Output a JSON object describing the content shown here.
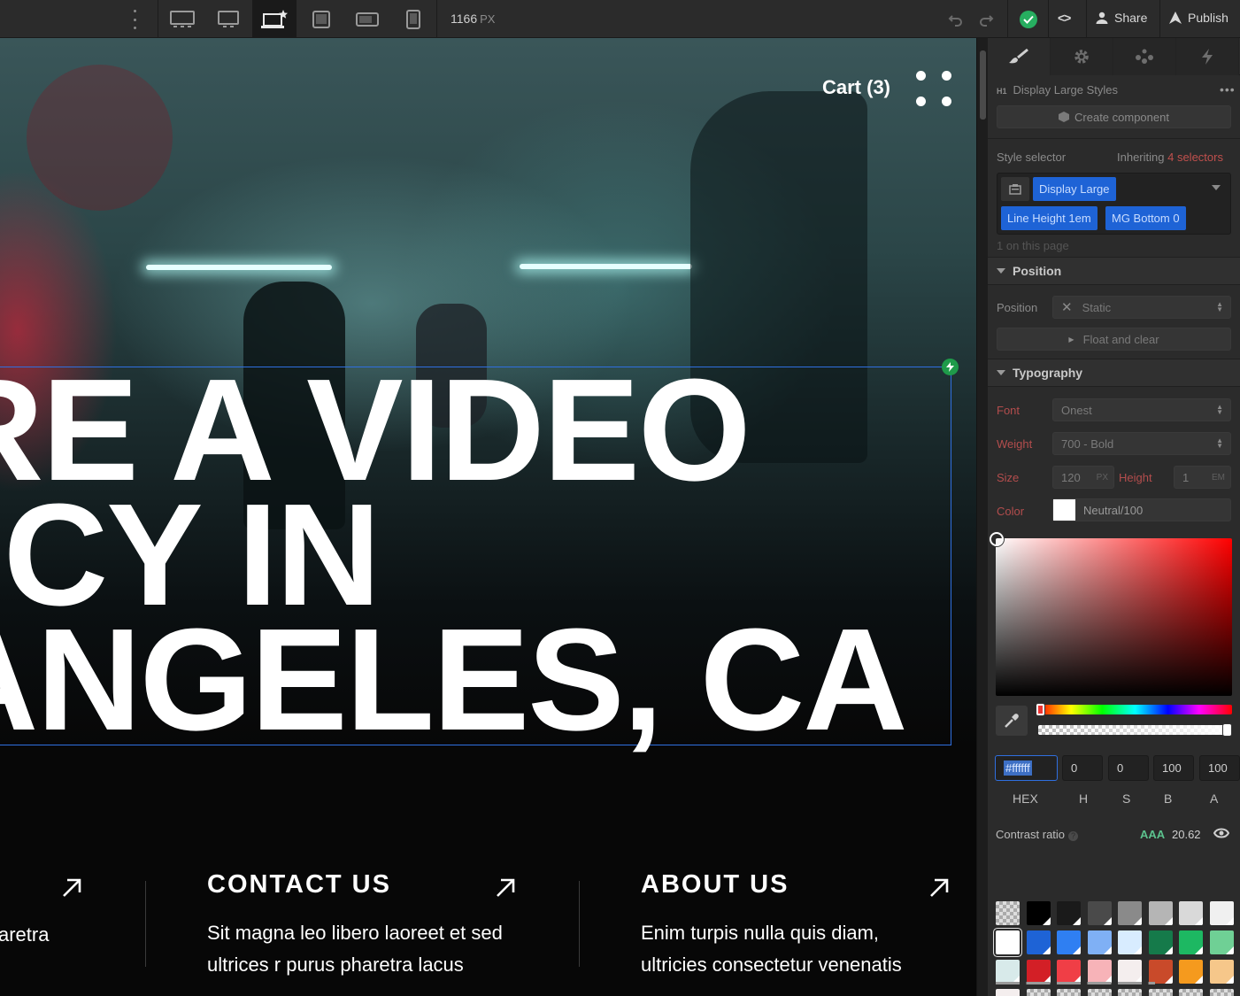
{
  "toolbar": {
    "canvas_width_value": "1166",
    "canvas_width_unit": "PX",
    "share_label": "Share",
    "publish_label": "Publish",
    "code_label": "<>",
    "devices": [
      "desktop-large-icon",
      "desktop-icon",
      "laptop-base-icon",
      "tablet-landscape-icon",
      "mobile-landscape-icon",
      "mobile-portrait-icon"
    ],
    "active_device": "laptop-base-icon"
  },
  "site": {
    "cart_label": "Cart (3)",
    "headline_lines": [
      "E’RE A VIDEO",
      "ENCY IN",
      "S ANGELES, CA"
    ],
    "columns": [
      {
        "title": "",
        "lines": [
          "aretra"
        ]
      },
      {
        "title": "CONTACT US",
        "lines": [
          "Sit magna leo libero laoreet et sed",
          "ultrices r purus pharetra lacus"
        ]
      },
      {
        "title": "ABOUT US",
        "lines": [
          "Enim turpis nulla quis diam,",
          "ultricies consectetur venenatis"
        ]
      }
    ]
  },
  "panel": {
    "tabs": [
      "style-brush-icon",
      "settings-gear-icon",
      "interactions-drops-icon",
      "lightning-icon"
    ],
    "element_tag": "H1",
    "element_name": "Display Large Styles",
    "create_component_label": "Create component",
    "style_selector_label": "Style selector",
    "inheriting_prefix": "Inheriting",
    "inheriting_link": "4 selectors",
    "chips": [
      "Display Large",
      "Line Height 1em",
      "MG Bottom 0"
    ],
    "on_page_note": "1 on this page",
    "position_section": "Position",
    "position_label": "Position",
    "position_value": "Static",
    "float_clear_label": "Float and clear",
    "typography_section": "Typography",
    "font_label": "Font",
    "font_value": "Onest",
    "weight_label": "Weight",
    "weight_value": "700 - Bold",
    "size_label": "Size",
    "size_value": "120",
    "size_unit": "PX",
    "height_label": "Height",
    "height_value": "1",
    "height_unit": "EM",
    "color_label": "Color",
    "color_value": "Neutral/100",
    "picker": {
      "hex": "#ffffff",
      "h": "0",
      "s": "0",
      "b": "100",
      "a": "100",
      "labels": [
        "HEX",
        "H",
        "S",
        "B",
        "A"
      ],
      "contrast_label": "Contrast ratio",
      "contrast_grade": "AAA",
      "contrast_value": "20.62",
      "swatches": [
        [
          "transparent",
          "#000000",
          "#1a1a1a",
          "#4a4a4a",
          "#8a8a8a",
          "#b5b5b5",
          "#d9d9d9",
          "#f0f0f0"
        ],
        [
          "#ffffff",
          "#1e63d6",
          "#2f7ff2",
          "#7fb0f5",
          "#d8ecff",
          "#157a4a",
          "#1db862",
          "#6fd095"
        ],
        [
          "#d8eaea",
          "#d31f26",
          "#f03e46",
          "#f7b3b8",
          "#f4eeee",
          "#c94a2a",
          "#f59a1e",
          "#f6c78a"
        ],
        [
          "#f4eeee",
          "check",
          "check",
          "check",
          "check",
          "check",
          "check",
          "check"
        ]
      ]
    }
  }
}
